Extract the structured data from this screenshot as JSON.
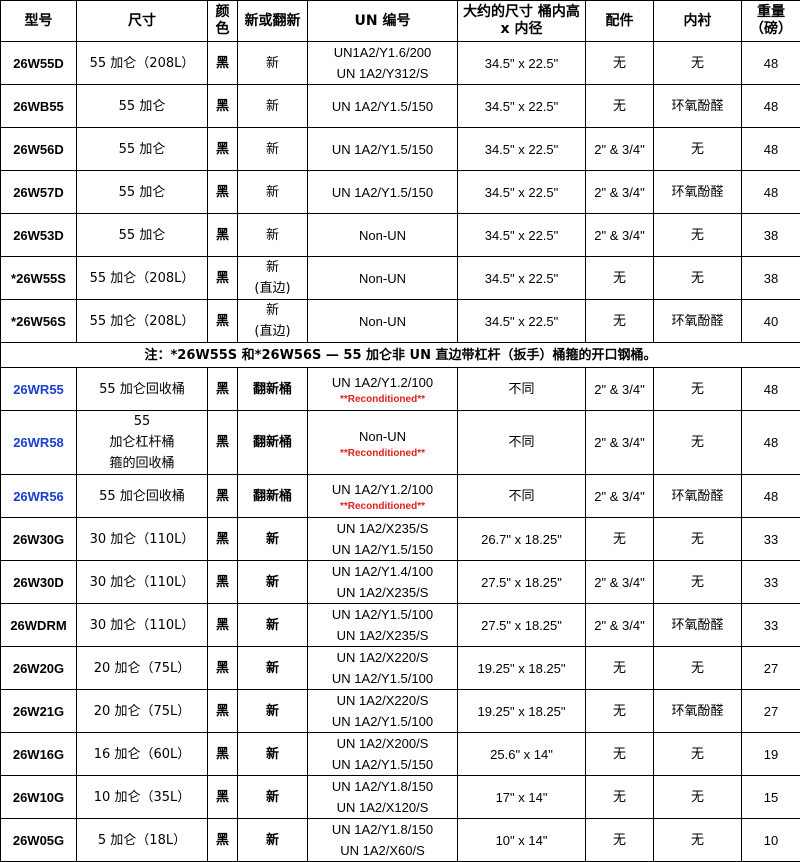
{
  "headers": {
    "model": "型号",
    "size": "尺寸",
    "color": "颜色",
    "new_or_recon": "新或翻新",
    "un": "UN 编号",
    "dims": "大约的尺寸 桶内高 x 内径",
    "fittings": "配件",
    "lining": "内衬",
    "weight": "重量（磅）"
  },
  "rows": [
    {
      "model": "26W55D",
      "size": "55 加仑（208L）",
      "color": "黑",
      "cond": "新",
      "un": [
        "UN1A2/Y1.6/200",
        "UN 1A2/Y312/S"
      ],
      "dims": "34.5\" x 22.5\"",
      "fit": "无",
      "lining": "无",
      "weight": "48"
    },
    {
      "model": "26WB55",
      "size": "55 加仑",
      "color": "黑",
      "cond": "新",
      "un": [
        "UN 1A2/Y1.5/150"
      ],
      "dims": "34.5\" x 22.5\"",
      "fit": "无",
      "lining": "环氧酚醛",
      "weight": "48"
    },
    {
      "model": "26W56D",
      "size": "55 加仑",
      "color": "黑",
      "cond": "新",
      "un": [
        "UN 1A2/Y1.5/150"
      ],
      "dims": "34.5\" x 22.5\"",
      "fit": "2\" & 3/4\"",
      "lining": "无",
      "weight": "48"
    },
    {
      "model": "26W57D",
      "size": "55 加仑",
      "color": "黑",
      "cond": "新",
      "un": [
        "UN 1A2/Y1.5/150"
      ],
      "dims": "34.5\" x 22.5\"",
      "fit": "2\" & 3/4\"",
      "lining": "环氧酚醛",
      "weight": "48"
    },
    {
      "model": "26W53D",
      "size": "55 加仑",
      "color": "黑",
      "cond": "新",
      "un": [
        "Non-UN"
      ],
      "dims": "34.5\" x 22.5\"",
      "fit": "2\" & 3/4\"",
      "lining": "无",
      "weight": "38"
    },
    {
      "model": "*26W55S",
      "size": "55 加仑（208L）",
      "color": "黑",
      "cond": "新 (直边)",
      "un": [
        "Non-UN"
      ],
      "dims": "34.5\" x 22.5\"",
      "fit": "无",
      "lining": "无",
      "weight": "38"
    },
    {
      "model": "*26W56S",
      "size": "55 加仑（208L）",
      "color": "黑",
      "cond": "新 (直边)",
      "un": [
        "Non-UN"
      ],
      "dims": "34.5\" x 22.5\"",
      "fit": "无",
      "lining": "环氧酚醛",
      "weight": "40"
    }
  ],
  "note": "注：*26W55S 和*26W56S — 55 加仑非 UN 直边带杠杆（扳手）桶箍的开口钢桶。",
  "rows2": [
    {
      "model": "26WR55",
      "size": "55 加仑回收桶",
      "color": "黑",
      "cond": "翻新桶",
      "un": [
        "UN 1A2/Y1.2/100"
      ],
      "recond": "**Reconditioned**",
      "dims": "不同",
      "fit": "2\" & 3/4\"",
      "lining": "无",
      "weight": "48"
    },
    {
      "model": "26WR58",
      "size": "55 加仑杠杆桶 箍的回收桶",
      "color": "黑",
      "cond": "翻新桶",
      "un": [
        "Non-UN"
      ],
      "recond": "**Reconditioned**",
      "dims": "不同",
      "fit": "2\" & 3/4\"",
      "lining": "无",
      "weight": "48"
    },
    {
      "model": "26WR56",
      "size": "55 加仑回收桶",
      "color": "黑",
      "cond": "翻新桶",
      "un": [
        "UN 1A2/Y1.2/100"
      ],
      "recond": "**Reconditioned**",
      "dims": "不同",
      "fit": "2\" & 3/4\"",
      "lining": "环氧酚醛",
      "weight": "48"
    },
    {
      "model": "26W30G",
      "size": "30 加仑（110L）",
      "color": "黑",
      "cond": "新",
      "un": [
        "UN 1A2/X235/S",
        "UN 1A2/Y1.5/150"
      ],
      "dims": "26.7\" x 18.25\"",
      "fit": "无",
      "lining": "无",
      "weight": "33"
    },
    {
      "model": "26W30D",
      "size": "30 加仑（110L）",
      "color": "黑",
      "cond": "新",
      "un": [
        "UN 1A2/Y1.4/100",
        "UN 1A2/X235/S"
      ],
      "dims": "27.5\" x 18.25\"",
      "fit": "2\" & 3/4\"",
      "lining": "无",
      "weight": "33"
    },
    {
      "model": "26WDRM",
      "size": "30 加仑（110L）",
      "color": "黑",
      "cond": "新",
      "un": [
        "UN 1A2/Y1.5/100",
        "UN 1A2/X235/S"
      ],
      "dims": "27.5\" x 18.25\"",
      "fit": "2\" & 3/4\"",
      "lining": "环氧酚醛",
      "weight": "33"
    },
    {
      "model": "26W20G",
      "size": "20 加仑（75L）",
      "color": "黑",
      "cond": "新",
      "un": [
        "UN 1A2/X220/S",
        "UN 1A2/Y1.5/100"
      ],
      "dims": "19.25\" x 18.25\"",
      "fit": "无",
      "lining": "无",
      "weight": "27"
    },
    {
      "model": "26W21G",
      "size": "20 加仑（75L）",
      "color": "黑",
      "cond": "新",
      "un": [
        "UN 1A2/X220/S",
        "UN 1A2/Y1.5/100"
      ],
      "dims": "19.25\" x 18.25\"",
      "fit": "无",
      "lining": "环氧酚醛",
      "weight": "27"
    },
    {
      "model": "26W16G",
      "size": "16 加仑（60L）",
      "color": "黑",
      "cond": "新",
      "un": [
        "UN 1A2/X200/S",
        "UN 1A2/Y1.5/150"
      ],
      "dims": "25.6\" x 14\"",
      "fit": "无",
      "lining": "无",
      "weight": "19"
    },
    {
      "model": "26W10G",
      "size": "10 加仑（35L）",
      "color": "黑",
      "cond": "新",
      "un": [
        "UN 1A2/Y1.8/150",
        "UN 1A2/X120/S"
      ],
      "dims": "17\" x 14\"",
      "fit": "无",
      "lining": "无",
      "weight": "15"
    },
    {
      "model": "26W05G",
      "size": "5 加仑（18L）",
      "color": "黑",
      "cond": "新",
      "un": [
        "UN 1A2/Y1.8/150",
        "UN 1A2/X60/S"
      ],
      "dims": "10\" x 14\"",
      "fit": "无",
      "lining": "无",
      "weight": "10"
    }
  ],
  "colors": {
    "blue_model": "#1a3fd0",
    "recond_red": "#e02020"
  }
}
